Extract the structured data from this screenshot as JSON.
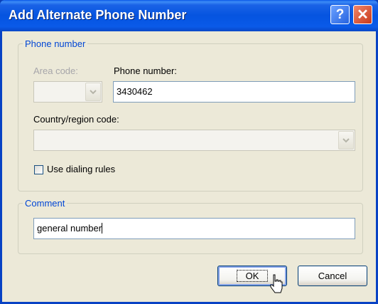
{
  "window": {
    "title": "Add Alternate Phone Number"
  },
  "phone_group": {
    "legend": "Phone number",
    "area_code_label": "Area code:",
    "phone_number_label": "Phone number:",
    "phone_number_value": "3430462",
    "country_label": "Country/region code:",
    "dialing_rules_label": "Use dialing rules",
    "dialing_rules_checked": false
  },
  "comment_group": {
    "legend": "Comment",
    "value": "general number"
  },
  "buttons": {
    "ok": "OK",
    "cancel": "Cancel"
  },
  "icons": {
    "help": "help-icon",
    "close": "close-icon",
    "combo_arrow": "chevron-down-icon",
    "cursor": "mouse-pointer-icon"
  }
}
